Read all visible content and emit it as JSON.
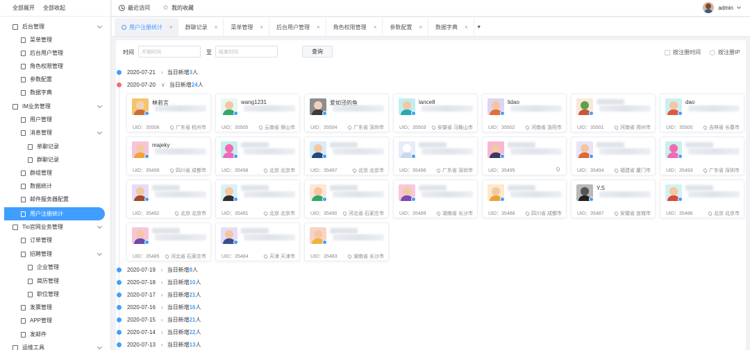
{
  "sidebar": {
    "top": {
      "expand_all": "全部展开",
      "collapse_all": "全部收起"
    },
    "items": [
      {
        "label": "后台管理",
        "level": 0,
        "chevron": true
      },
      {
        "label": "菜单管理",
        "level": 1
      },
      {
        "label": "后台用户管理",
        "level": 1
      },
      {
        "label": "角色权限管理",
        "level": 1
      },
      {
        "label": "参数配置",
        "level": 1
      },
      {
        "label": "数据字典",
        "level": 1
      },
      {
        "label": "IM业务管理",
        "level": 0,
        "chevron": true
      },
      {
        "label": "用户管理",
        "level": 1
      },
      {
        "label": "消息管理",
        "level": 1,
        "chevron": true
      },
      {
        "label": "单聊记录",
        "level": 2
      },
      {
        "label": "群聊记录",
        "level": 2
      },
      {
        "label": "群组管理",
        "level": 1
      },
      {
        "label": "数据统计",
        "level": 1
      },
      {
        "label": "邮件服务器配置",
        "level": 1
      },
      {
        "label": "用户注册统计",
        "level": 1,
        "active": true
      },
      {
        "label": "Tio官网业务管理",
        "level": 0,
        "chevron": true
      },
      {
        "label": "订单管理",
        "level": 1
      },
      {
        "label": "招聘管理",
        "level": 1,
        "chevron": true
      },
      {
        "label": "企业管理",
        "level": 2
      },
      {
        "label": "简历管理",
        "level": 2
      },
      {
        "label": "职位管理",
        "level": 2
      },
      {
        "label": "发票管理",
        "level": 1
      },
      {
        "label": "APP管理",
        "level": 1
      },
      {
        "label": "发邮件",
        "level": 1
      },
      {
        "label": "运维工具",
        "level": 0,
        "chevron": true
      }
    ]
  },
  "header": {
    "recent": "最近访问",
    "favorites": "我的收藏",
    "username": "admin"
  },
  "tabs": [
    "用户注册统计",
    "群聊记录",
    "菜单管理",
    "后台用户管理",
    "角色权限管理",
    "参数配置",
    "数据字典"
  ],
  "filter": {
    "time_label": "时间",
    "start_placeholder": "开始时间",
    "separator": "至",
    "end_placeholder": "结束时间",
    "query_button": "查询",
    "by_time": "按注册时间",
    "by_ip": "按注册IP"
  },
  "timeline": [
    {
      "date": "2020-07-21",
      "prefix": "当日新增",
      "count": "3",
      "suffix": "人"
    },
    {
      "date": "2020-07-20",
      "prefix": "当日新增",
      "count": "24",
      "suffix": "人",
      "expanded": true
    },
    {
      "date": "2020-07-19",
      "prefix": "当日新增",
      "count": "8",
      "suffix": "人"
    },
    {
      "date": "2020-07-18",
      "prefix": "当日新增",
      "count": "10",
      "suffix": "人"
    },
    {
      "date": "2020-07-17",
      "prefix": "当日新增",
      "count": "21",
      "suffix": "人"
    },
    {
      "date": "2020-07-16",
      "prefix": "当日新增",
      "count": "16",
      "suffix": "人"
    },
    {
      "date": "2020-07-15",
      "prefix": "当日新增",
      "count": "21",
      "suffix": "人"
    },
    {
      "date": "2020-07-14",
      "prefix": "当日新增",
      "count": "22",
      "suffix": "人"
    },
    {
      "date": "2020-07-13",
      "prefix": "当日新增",
      "count": "13",
      "suffix": "人"
    }
  ],
  "cards": [
    {
      "nick": "林若言",
      "uid": "UID：35506",
      "loc": "广东省 杭州市",
      "bg": "#f7c36b",
      "face": "#f2d2b6",
      "body": "#c86d3c"
    },
    {
      "nick": "wang1231",
      "uid": "UID：35505",
      "loc": "云南省 保山市",
      "bg": "#eaf6f1",
      "face": "#f3c7a5",
      "body": "#2fa86b"
    },
    {
      "nick": "爱如泾的鱼",
      "uid": "UID：35504",
      "loc": "广东省 深圳市",
      "bg": "#8e8e8e",
      "face": "#f1d0bd",
      "body": "#3b3b3b"
    },
    {
      "nick": "lance8",
      "uid": "UID：35503",
      "loc": "安徽省 马鞍山市",
      "bg": "#bfeff0",
      "face": "#f4c6a1",
      "body": "#2aa7b2"
    },
    {
      "nick": "lidao",
      "uid": "UID：35502",
      "loc": "河南省 洛阳市",
      "bg": "#ded4f6",
      "face": "#f3c6a0",
      "body": "#e46b3a"
    },
    {
      "nick": "",
      "uid": "UID：35501",
      "loc": "河南省 郑州市",
      "bg": "#fbe7d9",
      "face": "#5aa24a",
      "body": "#c9573a"
    },
    {
      "nick": "dao",
      "uid": "UID：35500",
      "loc": "吉林省 长春市",
      "bg": "#cdeef4",
      "face": "#f4c6a1",
      "body": "#df5a3e"
    },
    {
      "nick": "majeky",
      "uid": "UID：35499",
      "loc": "四川省 成都市",
      "bg": "#f6c4dd",
      "face": "#f3c8a6",
      "body": "#f0a43c"
    },
    {
      "nick": "",
      "uid": "UID：35498",
      "loc": "北京 北京市",
      "bg": "#c8f0ee",
      "face": "#f06ab4",
      "body": "#f06ab4"
    },
    {
      "nick": "",
      "uid": "UID：35497",
      "loc": "北京 北京市",
      "bg": "#d9ecfb",
      "face": "#f4c6a1",
      "body": "#244a7c"
    },
    {
      "nick": "",
      "uid": "UID：35496",
      "loc": "广东省 深圳市",
      "bg": "#e6ecf8",
      "face": "#ffffff",
      "body": "#c9d6ee"
    },
    {
      "nick": "",
      "uid": "UID：35495",
      "loc": "",
      "bg": "#f7b7d4",
      "face": "#f3c8a6",
      "body": "#3a3a5c"
    },
    {
      "nick": "",
      "uid": "UID：35494",
      "loc": "福建省 厦门市",
      "bg": "#e9e3fa",
      "face": "#f3c6a0",
      "body": "#d96a3a"
    },
    {
      "nick": "",
      "uid": "UID：35493",
      "loc": "广东省 深圳市",
      "bg": "#c8f0ee",
      "face": "#f06ab4",
      "body": "#f06ab4"
    },
    {
      "nick": "",
      "uid": "UID：35492",
      "loc": "北京 北京市",
      "bg": "#e6dcf7",
      "face": "#f3c6a0",
      "body": "#a34b2c"
    },
    {
      "nick": "",
      "uid": "UID：35491",
      "loc": "北京 北京市",
      "bg": "#d8f2f6",
      "face": "#f4c6a1",
      "body": "#2e2e2e"
    },
    {
      "nick": "",
      "uid": "UID：35490",
      "loc": "河北省 石家庄市",
      "bg": "#fde6d6",
      "face": "#f4c6a1",
      "body": "#2faa6b"
    },
    {
      "nick": "",
      "uid": "UID：35489",
      "loc": "湖南省 长沙市",
      "bg": "#f9c7dc",
      "face": "#f3c8a6",
      "body": "#7a4bb0"
    },
    {
      "nick": "",
      "uid": "UID：35488",
      "loc": "四川省 成都市",
      "bg": "#fde8c8",
      "face": "#f3c8a6",
      "body": "#e6a53a"
    },
    {
      "nick": "Y.S",
      "uid": "UID：35487",
      "loc": "安徽省 宣城市",
      "bg": "#b8b8b8",
      "face": "#555555",
      "body": "#222222"
    },
    {
      "nick": "",
      "uid": "UID：35486",
      "loc": "北京 北京市",
      "bg": "#d3f1f2",
      "face": "#f4c6a1",
      "body": "#d84a3a"
    },
    {
      "nick": "",
      "uid": "UID：35485",
      "loc": "河北省 石家庄市",
      "bg": "#f8c5da",
      "face": "#f3c8a6",
      "body": "#6a4bb0"
    },
    {
      "nick": "",
      "uid": "UID：35484",
      "loc": "天津 天津市",
      "bg": "#e5ddf7",
      "face": "#f3c6a0",
      "body": "#3a4f8c"
    },
    {
      "nick": "",
      "uid": "UID：35483",
      "loc": "湖南省 长沙市",
      "bg": "#fbd2c6",
      "face": "#f3c8a6",
      "body": "#f0b43c"
    }
  ]
}
